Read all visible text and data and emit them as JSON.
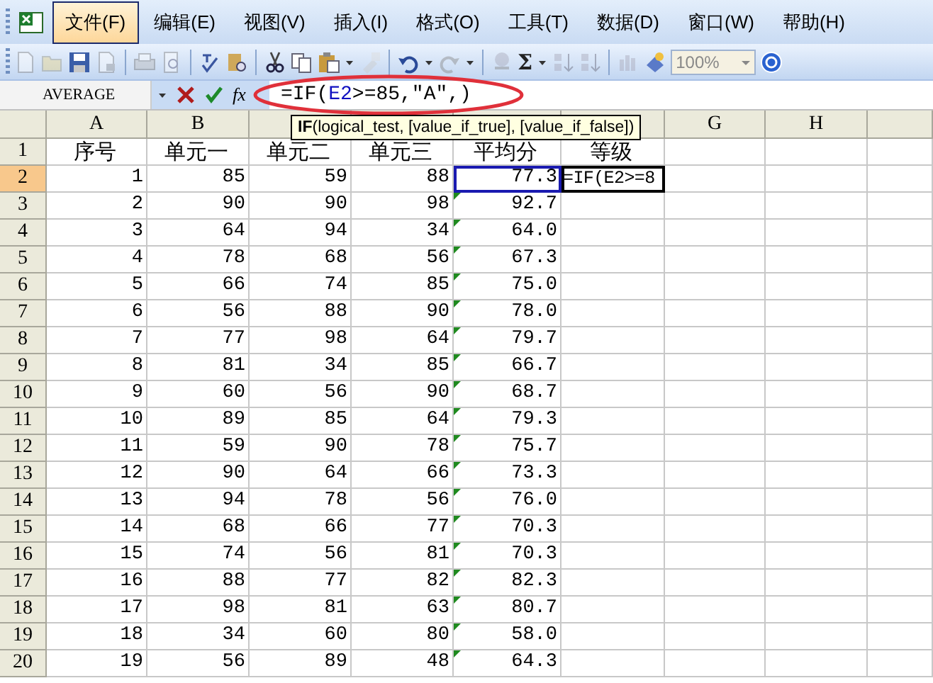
{
  "menu": [
    {
      "label": "文件(F)",
      "selected": true
    },
    {
      "label": "编辑(E)",
      "selected": false
    },
    {
      "label": "视图(V)",
      "selected": false
    },
    {
      "label": "插入(I)",
      "selected": false
    },
    {
      "label": "格式(O)",
      "selected": false
    },
    {
      "label": "工具(T)",
      "selected": false
    },
    {
      "label": "数据(D)",
      "selected": false
    },
    {
      "label": "窗口(W)",
      "selected": false
    },
    {
      "label": "帮助(H)",
      "selected": false
    }
  ],
  "toolbar": {
    "autosum_symbol": "Σ",
    "zoom": "100%"
  },
  "formula_bar": {
    "name_box": "AVERAGE",
    "function_label": "fx",
    "circled": true,
    "formula": {
      "before": "=IF(",
      "reference": "E2",
      "after": ">=85,\"A\",)"
    }
  },
  "tooltip": "**IF**(logical_test, [value_if_true], [value_if_false])",
  "columns": [
    {
      "label": "A"
    },
    {
      "label": "B"
    },
    {},
    {},
    {},
    {},
    {
      "label": "G"
    },
    {
      "label": "H"
    },
    {}
  ],
  "header_row": {
    "number": "1",
    "cells": [
      "序号",
      "单元一",
      "单元二",
      "单元三",
      "平均分",
      "等级"
    ]
  },
  "rows": [
    {
      "number": "2",
      "selected": true,
      "cells": [
        "1",
        "85",
        "59",
        "88",
        "77.3"
      ],
      "referenced": true,
      "flagged": false,
      "grade": "=IF(E2>=8",
      "active": true
    },
    {
      "number": "3",
      "selected": false,
      "cells": [
        "2",
        "90",
        "90",
        "98",
        "92.7"
      ],
      "referenced": false,
      "flagged": true,
      "active": false
    },
    {
      "number": "4",
      "selected": false,
      "cells": [
        "3",
        "64",
        "94",
        "34",
        "64.0"
      ],
      "referenced": false,
      "flagged": true,
      "active": false
    },
    {
      "number": "5",
      "selected": false,
      "cells": [
        "4",
        "78",
        "68",
        "56",
        "67.3"
      ],
      "referenced": false,
      "flagged": true,
      "active": false
    },
    {
      "number": "6",
      "selected": false,
      "cells": [
        "5",
        "66",
        "74",
        "85",
        "75.0"
      ],
      "referenced": false,
      "flagged": true,
      "active": false
    },
    {
      "number": "7",
      "selected": false,
      "cells": [
        "6",
        "56",
        "88",
        "90",
        "78.0"
      ],
      "referenced": false,
      "flagged": true,
      "active": false
    },
    {
      "number": "8",
      "selected": false,
      "cells": [
        "7",
        "77",
        "98",
        "64",
        "79.7"
      ],
      "referenced": false,
      "flagged": true,
      "active": false
    },
    {
      "number": "9",
      "selected": false,
      "cells": [
        "8",
        "81",
        "34",
        "85",
        "66.7"
      ],
      "referenced": false,
      "flagged": true,
      "active": false
    },
    {
      "number": "10",
      "selected": false,
      "cells": [
        "9",
        "60",
        "56",
        "90",
        "68.7"
      ],
      "referenced": false,
      "flagged": true,
      "active": false
    },
    {
      "number": "11",
      "selected": false,
      "cells": [
        "10",
        "89",
        "85",
        "64",
        "79.3"
      ],
      "referenced": false,
      "flagged": true,
      "active": false
    },
    {
      "number": "12",
      "selected": false,
      "cells": [
        "11",
        "59",
        "90",
        "78",
        "75.7"
      ],
      "referenced": false,
      "flagged": true,
      "active": false
    },
    {
      "number": "13",
      "selected": false,
      "cells": [
        "12",
        "90",
        "64",
        "66",
        "73.3"
      ],
      "referenced": false,
      "flagged": true,
      "active": false
    },
    {
      "number": "14",
      "selected": false,
      "cells": [
        "13",
        "94",
        "78",
        "56",
        "76.0"
      ],
      "referenced": false,
      "flagged": true,
      "active": false
    },
    {
      "number": "15",
      "selected": false,
      "cells": [
        "14",
        "68",
        "66",
        "77",
        "70.3"
      ],
      "referenced": false,
      "flagged": true,
      "active": false
    },
    {
      "number": "16",
      "selected": false,
      "cells": [
        "15",
        "74",
        "56",
        "81",
        "70.3"
      ],
      "referenced": false,
      "flagged": true,
      "active": false
    },
    {
      "number": "17",
      "selected": false,
      "cells": [
        "16",
        "88",
        "77",
        "82",
        "82.3"
      ],
      "referenced": false,
      "flagged": true,
      "active": false
    },
    {
      "number": "18",
      "selected": false,
      "cells": [
        "17",
        "98",
        "81",
        "63",
        "80.7"
      ],
      "referenced": false,
      "flagged": true,
      "active": false
    },
    {
      "number": "19",
      "selected": false,
      "cells": [
        "18",
        "34",
        "60",
        "80",
        "58.0"
      ],
      "referenced": false,
      "flagged": true,
      "active": false
    },
    {
      "number": "20",
      "selected": false,
      "cells": [
        "19",
        "56",
        "89",
        "48",
        "64.3"
      ],
      "referenced": false,
      "flagged": true,
      "active": false
    }
  ]
}
